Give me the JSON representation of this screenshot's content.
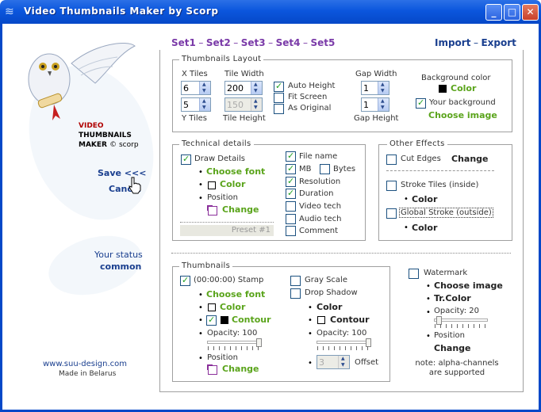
{
  "window": {
    "title": "Video Thumbnails Maker by Scorp"
  },
  "sidebar": {
    "logo_lines": [
      "VIDEO",
      "THUMBNAILS",
      "MAKER"
    ],
    "logo_brand": "© scorp",
    "save": "Save <<<",
    "cancel": "Cancel",
    "status_label": "Your status",
    "status_value": "common",
    "site": "www.suu-design.com",
    "made": "Made in Belarus"
  },
  "tabs": [
    "Set1",
    "Set2",
    "Set3",
    "Set4",
    "Set5"
  ],
  "tab_sep": "–",
  "import_label": "Import",
  "export_label": "Export",
  "layout": {
    "title": "Thumbnails Layout",
    "x_tiles_label": "X Tiles",
    "x_tiles": "6",
    "y_tiles_label": "Y Tiles",
    "y_tiles": "5",
    "tile_width_label": "Tile Width",
    "tile_width": "200",
    "tile_height_label": "Tile Height",
    "tile_height": "150",
    "auto_height": "Auto Height",
    "fit_screen": "Fit Screen",
    "as_original": "As Original",
    "gap_width_label": "Gap Width",
    "gap_width": "1",
    "gap_height_label": "Gap Height",
    "gap_height": "1",
    "bg_color_label": "Background color",
    "bg_color_link": "Color",
    "your_bg": "Your background",
    "choose_image": "Choose image"
  },
  "technical": {
    "title": "Technical details",
    "draw_details": "Draw Details",
    "choose_font": "Choose font",
    "color": "Color",
    "position": "Position",
    "change": "Change",
    "preset": "Preset #1",
    "file_name": "File name",
    "mb": "MB",
    "bytes": "Bytes",
    "resolution": "Resolution",
    "duration": "Duration",
    "video_tech": "Video tech",
    "audio_tech": "Audio tech",
    "comment": "Comment"
  },
  "other": {
    "title": "Other Effects",
    "cut_edges": "Cut Edges",
    "change": "Change",
    "stroke_tiles": "Stroke Tiles (inside)",
    "color1": "Color",
    "global_stroke": "Global Stroke (outside)",
    "color2": "Color"
  },
  "thumbs": {
    "title": "Thumbnails",
    "stamp": "(00:00:00) Stamp",
    "choose_font": "Choose font",
    "color": "Color",
    "contour": "Contour",
    "opacity": "Opacity: 100",
    "position": "Position",
    "change": "Change",
    "gray_scale": "Gray Scale",
    "drop_shadow": "Drop Shadow",
    "ds_color": "Color",
    "ds_contour": "Contour",
    "ds_opacity": "Opacity: 100",
    "offset_value": "3",
    "offset": "Offset"
  },
  "watermark": {
    "title": "Watermark",
    "choose_image": "Choose image",
    "tr_color": "Tr.Color",
    "opacity": "Opacity: 20",
    "position": "Position",
    "change": "Change",
    "note": "note: alpha-channels are supported"
  }
}
